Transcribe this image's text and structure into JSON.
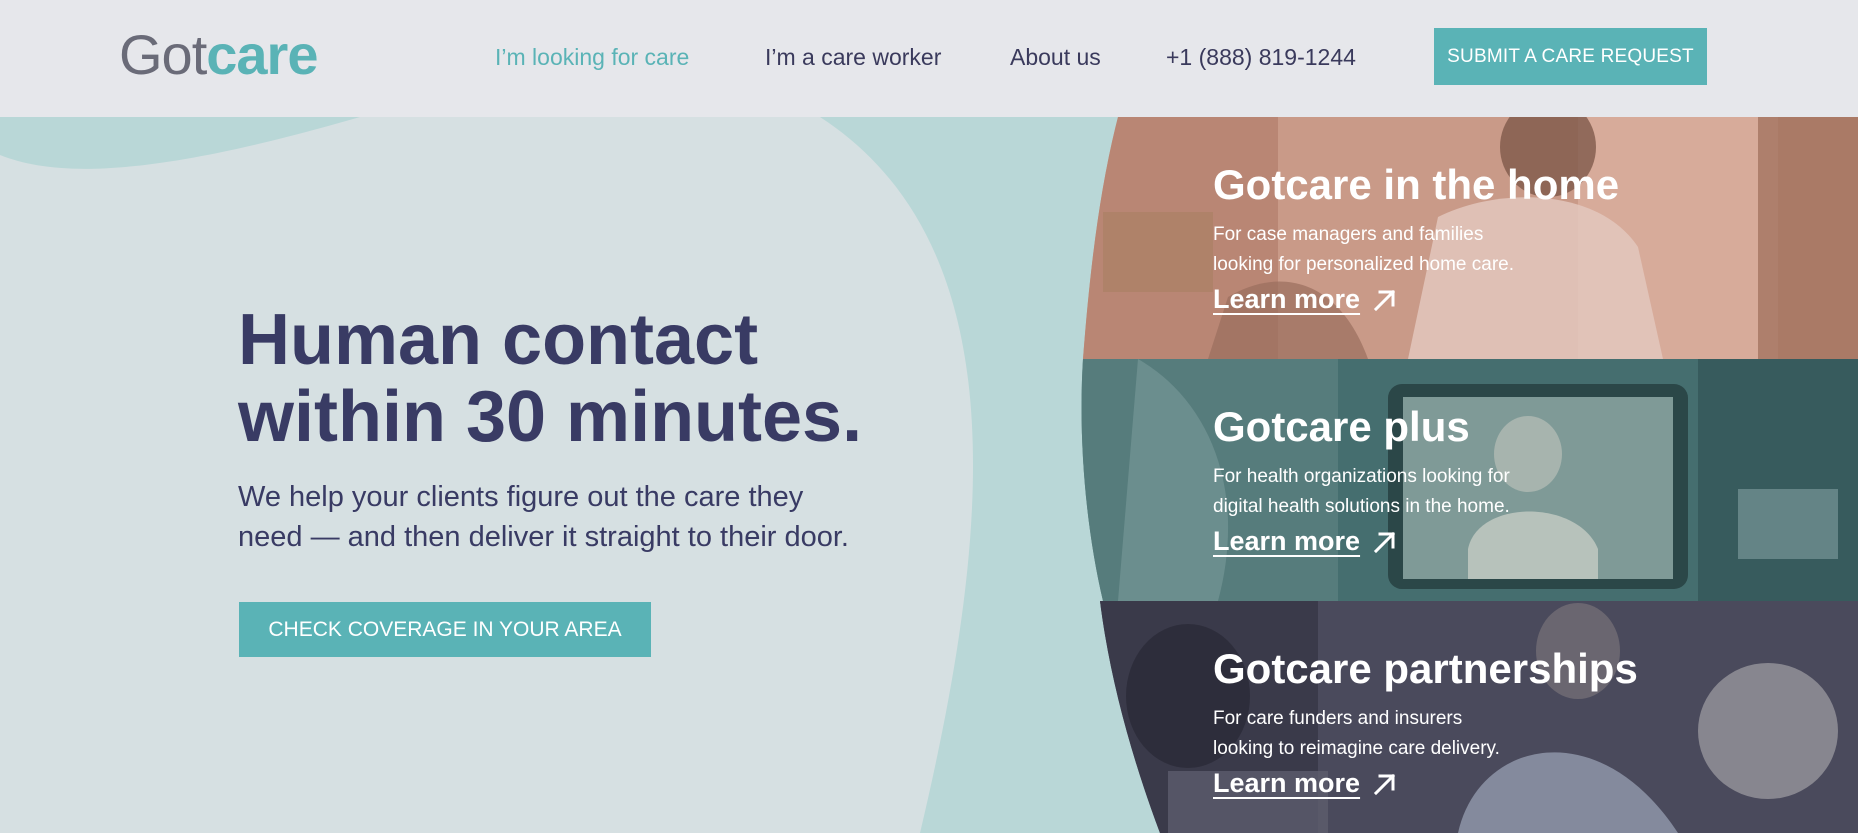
{
  "header": {
    "logo_part1": "Got",
    "logo_part2": "care",
    "nav": [
      "I’m looking for care",
      "I’m a care worker",
      "About us",
      "+1 (888) 819-1244"
    ],
    "submit_label": "SUBMIT A CARE REQUEST"
  },
  "hero": {
    "headline_line1": "Human contact",
    "headline_line2": "within 30 minutes.",
    "sub_line1": "We help your clients figure out the care they",
    "sub_line2": "need — and then deliver it straight to their door.",
    "cta_label": "CHECK COVERAGE IN YOUR AREA"
  },
  "panels": [
    {
      "title": "Gotcare in the home",
      "desc_line1": "For case managers and families",
      "desc_line2": "looking for personalized home care.",
      "link": "Learn more"
    },
    {
      "title": "Gotcare plus",
      "desc_line1": "For health organizations looking for",
      "desc_line2": "digital health solutions in the home.",
      "link": "Learn more"
    },
    {
      "title": "Gotcare partnerships",
      "desc_line1": "For care funders and insurers",
      "desc_line2": "looking to reimagine care delivery.",
      "link": "Learn more"
    }
  ],
  "colors": {
    "accent": "#5ab3b6",
    "text_dark": "#393b64",
    "header_bg": "#e6e7eb",
    "hero_bg": "#d6e0e2",
    "blob": "#b9d7d7"
  }
}
